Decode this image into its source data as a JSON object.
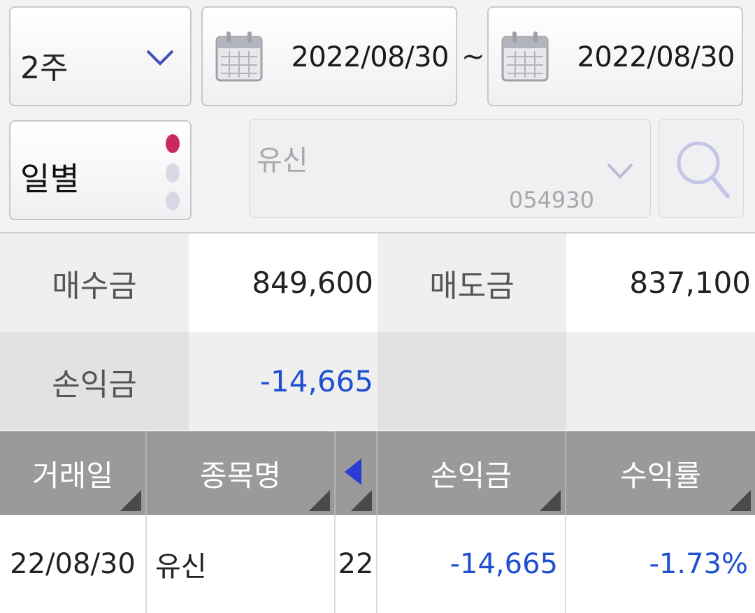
{
  "filters": {
    "period": {
      "label": "2주",
      "icon": "chevron-down-icon"
    },
    "start_date": {
      "value": "2022/08/30",
      "icon": "calendar-icon"
    },
    "separator": "~",
    "end_date": {
      "value": "2022/08/30",
      "icon": "calendar-icon"
    },
    "unit": {
      "label": "일별",
      "selected_index": 0,
      "options_count": 3
    },
    "stock": {
      "name": "유신",
      "code": "054930",
      "icon": "chevron-down-icon"
    },
    "search": {
      "icon": "search-icon"
    }
  },
  "summary": {
    "buy_label": "매수금",
    "buy_value": "849,600",
    "sell_label": "매도금",
    "sell_value": "837,100",
    "pl_label": "손익금",
    "pl_value": "-14,665"
  },
  "table": {
    "columns": [
      "거래일",
      "종목명",
      "손익금",
      "수익률"
    ],
    "rows": [
      {
        "date": "22/08/30",
        "name": "유신",
        "qty": "22",
        "pl": "-14,665",
        "rate": "-1.73%"
      }
    ]
  },
  "colors": {
    "negative": "#1f4fd1",
    "accent_dot": "#cc2a5c",
    "header_bg": "#9a9a9a"
  }
}
